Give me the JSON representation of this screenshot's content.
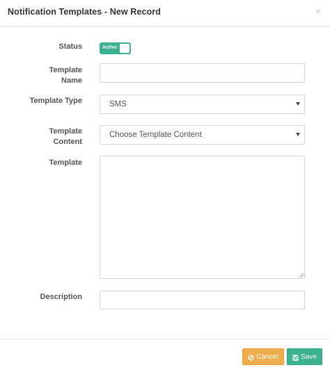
{
  "dialog": {
    "title": "Notification Templates - New Record",
    "close_symbol": "×"
  },
  "form": {
    "status": {
      "label": "Status",
      "toggle_text": "Active",
      "checked": true
    },
    "template_name": {
      "label_line1": "Template",
      "label_line2": "Name",
      "value": ""
    },
    "template_type": {
      "label": "Template Type",
      "selected": "SMS"
    },
    "template_content": {
      "label_line1": "Template",
      "label_line2": "Content",
      "selected": "Choose Template Content"
    },
    "template": {
      "label": "Template",
      "value": ""
    },
    "description": {
      "label": "Description",
      "value": ""
    }
  },
  "footer": {
    "cancel_label": "Cancel",
    "cancel_icon": "ban-icon",
    "save_label": "Save",
    "save_icon": "floppy-disk-icon"
  },
  "colors": {
    "accent_green": "#3bb18f",
    "cancel_orange": "#f0ad4e"
  }
}
